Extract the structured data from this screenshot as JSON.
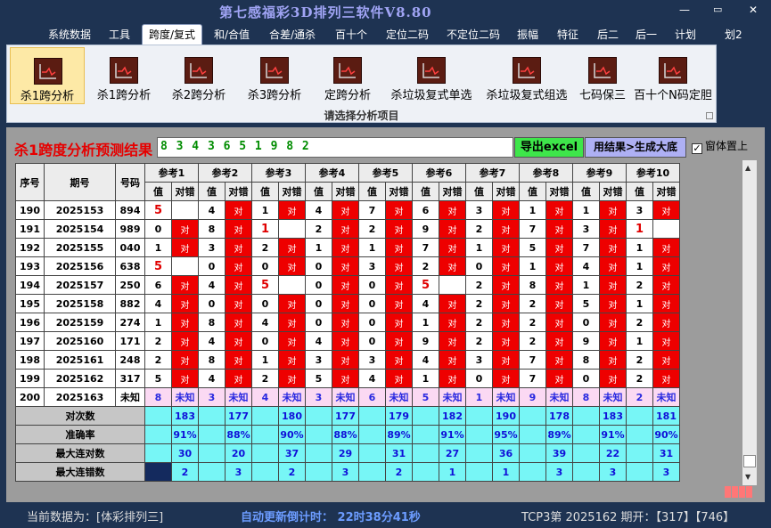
{
  "window": {
    "title": "第七感福彩3D排列三软件V8.80",
    "btn_minimize": "—",
    "btn_restore": "▭",
    "btn_close": "✕"
  },
  "menu": [
    "系统数据",
    "工具",
    "跨度/复式",
    "和/合值",
    "合差/通杀",
    "百十个",
    "定位二码",
    "不定位二码",
    "振幅",
    "特征",
    "后二",
    "后一",
    "计划",
    "划2"
  ],
  "ribbon": {
    "buttons": [
      "杀1跨分析",
      "杀1跨分析",
      "杀2跨分析",
      "杀3跨分析",
      "定跨分析",
      "杀垃圾复式单选",
      "杀垃圾复式组选",
      "七码保三",
      "百十个N码定胆"
    ],
    "caption": "请选择分析项目"
  },
  "analysis": {
    "title": "杀1跨度分析预测结果",
    "result": "8 3 4 3 6 5 1 9 8 2",
    "export_label": "导出excel",
    "generate_label": "用结果>生成大底",
    "ontop_label": "窗体置上",
    "ontop_checked": "✓"
  },
  "table": {
    "head_seq": "序号",
    "head_period": "期号",
    "head_code": "号码",
    "refs": [
      "参考1",
      "参考2",
      "参考3",
      "参考4",
      "参考5",
      "参考6",
      "参考7",
      "参考8",
      "参考9",
      "参考10"
    ],
    "sub_val": "值",
    "sub_ok": "对错",
    "ok": "对",
    "unknown": "未知",
    "rows": [
      {
        "seq": "190",
        "period": "2025153",
        "code": "894",
        "vals": [
          "5",
          "4",
          "1",
          "4",
          "7",
          "6",
          "3",
          "1",
          "1",
          "3"
        ],
        "hits": [
          0,
          1,
          1,
          1,
          1,
          1,
          1,
          1,
          1,
          1
        ]
      },
      {
        "seq": "191",
        "period": "2025154",
        "code": "989",
        "vals": [
          "0",
          "8",
          "1",
          "2",
          "2",
          "9",
          "2",
          "7",
          "3",
          "1"
        ],
        "hits": [
          1,
          1,
          0,
          1,
          1,
          1,
          1,
          1,
          1,
          0
        ]
      },
      {
        "seq": "192",
        "period": "2025155",
        "code": "040",
        "vals": [
          "1",
          "3",
          "2",
          "1",
          "1",
          "7",
          "1",
          "5",
          "7",
          "1"
        ],
        "hits": [
          1,
          1,
          1,
          1,
          1,
          1,
          1,
          1,
          1,
          1
        ]
      },
      {
        "seq": "193",
        "period": "2025156",
        "code": "638",
        "vals": [
          "5",
          "0",
          "0",
          "0",
          "3",
          "2",
          "0",
          "1",
          "4",
          "1"
        ],
        "hits": [
          0,
          1,
          1,
          1,
          1,
          1,
          1,
          1,
          1,
          1
        ]
      },
      {
        "seq": "194",
        "period": "2025157",
        "code": "250",
        "vals": [
          "6",
          "4",
          "5",
          "0",
          "0",
          "5",
          "2",
          "8",
          "1",
          "2"
        ],
        "hits": [
          1,
          1,
          0,
          1,
          1,
          0,
          1,
          1,
          1,
          1
        ]
      },
      {
        "seq": "195",
        "period": "2025158",
        "code": "882",
        "vals": [
          "4",
          "0",
          "0",
          "0",
          "0",
          "4",
          "2",
          "2",
          "5",
          "1"
        ],
        "hits": [
          1,
          1,
          1,
          1,
          1,
          1,
          1,
          1,
          1,
          1
        ]
      },
      {
        "seq": "196",
        "period": "2025159",
        "code": "274",
        "vals": [
          "1",
          "8",
          "4",
          "0",
          "0",
          "1",
          "2",
          "2",
          "0",
          "2"
        ],
        "hits": [
          1,
          1,
          1,
          1,
          1,
          1,
          1,
          1,
          1,
          1
        ]
      },
      {
        "seq": "197",
        "period": "2025160",
        "code": "171",
        "vals": [
          "2",
          "4",
          "0",
          "4",
          "0",
          "9",
          "2",
          "2",
          "9",
          "1"
        ],
        "hits": [
          1,
          1,
          1,
          1,
          1,
          1,
          1,
          1,
          1,
          1
        ]
      },
      {
        "seq": "198",
        "period": "2025161",
        "code": "248",
        "vals": [
          "2",
          "8",
          "1",
          "3",
          "3",
          "4",
          "3",
          "7",
          "8",
          "2"
        ],
        "hits": [
          1,
          1,
          1,
          1,
          1,
          1,
          1,
          1,
          1,
          1
        ]
      },
      {
        "seq": "199",
        "period": "2025162",
        "code": "317",
        "vals": [
          "5",
          "4",
          "2",
          "5",
          "4",
          "1",
          "0",
          "7",
          "0",
          "2"
        ],
        "hits": [
          1,
          1,
          1,
          1,
          1,
          1,
          1,
          1,
          1,
          1
        ]
      }
    ],
    "pending": {
      "seq": "200",
      "period": "2025163",
      "code": "未知",
      "vals": [
        "8",
        "3",
        "4",
        "3",
        "6",
        "5",
        "1",
        "9",
        "8",
        "2"
      ]
    },
    "stats": [
      {
        "label": "对次数",
        "values": [
          "183",
          "177",
          "180",
          "177",
          "179",
          "182",
          "190",
          "178",
          "183",
          "181"
        ]
      },
      {
        "label": "准确率",
        "values": [
          "91%",
          "88%",
          "90%",
          "88%",
          "89%",
          "91%",
          "95%",
          "89%",
          "91%",
          "90%"
        ]
      },
      {
        "label": "最大连对数",
        "values": [
          "30",
          "20",
          "37",
          "29",
          "31",
          "27",
          "36",
          "39",
          "22",
          "31"
        ]
      },
      {
        "label": "最大连错数",
        "values": [
          "2",
          "3",
          "2",
          "3",
          "2",
          "1",
          "1",
          "3",
          "3",
          "3"
        ]
      }
    ]
  },
  "status": {
    "data_source": "当前数据为：[体彩排列三]",
    "countdown": "自动更新倒计时：  22时38分41秒",
    "issue": "TCP3第 2025162 期开：【317】【746】"
  },
  "colors": {
    "hit": "#ee0000",
    "stat_bg": "#77f6f6",
    "pending_bg": "#fbd9f3",
    "title_red": "#e60000",
    "export_green": "#3ee64a",
    "generate_purple": "#aeb0f4"
  }
}
